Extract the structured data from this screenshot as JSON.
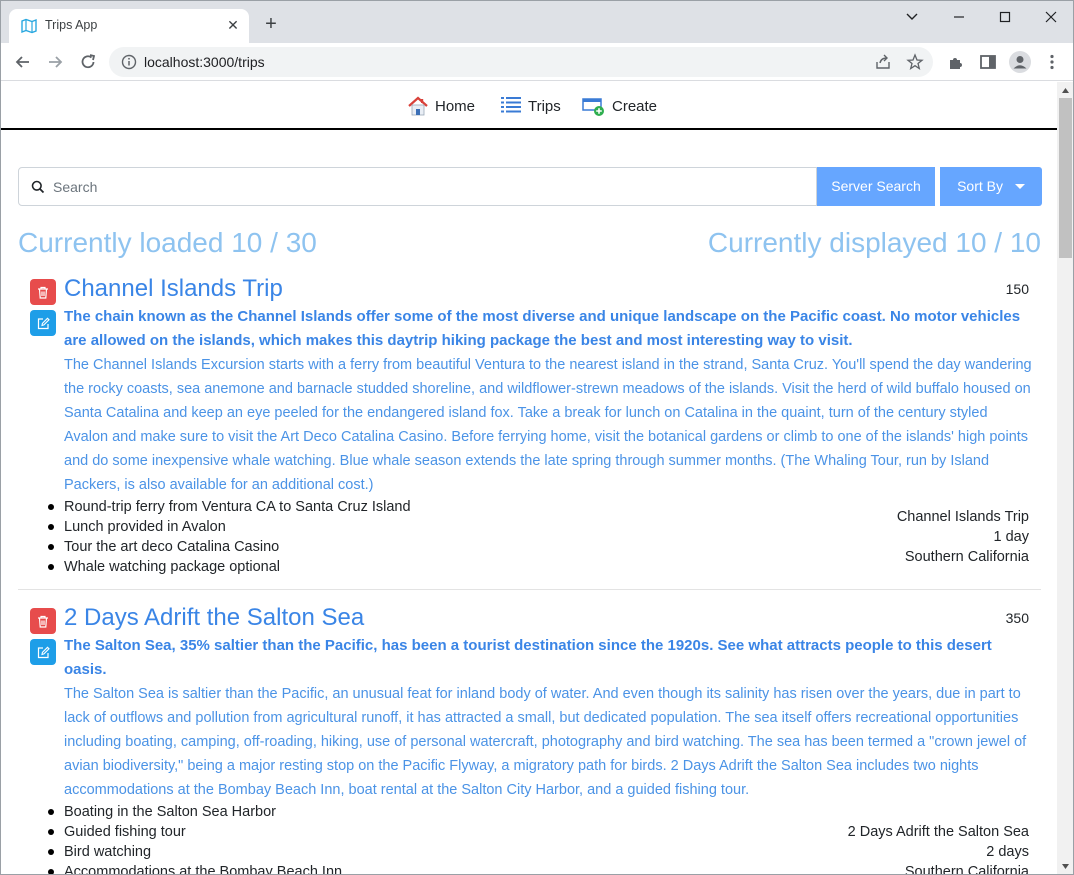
{
  "browser": {
    "tab_title": "Trips App",
    "tab_close": "✕",
    "new_tab": "+",
    "url": "localhost:3000/trips",
    "min": "—",
    "max": "☐",
    "close": "✕"
  },
  "nav": {
    "home": "Home",
    "trips": "Trips",
    "create": "Create"
  },
  "search": {
    "placeholder": "Search",
    "value": "",
    "server_search_label": "Server Search",
    "sort_by_label": "Sort By"
  },
  "status": {
    "loaded": "Currently loaded 10 / 30",
    "displayed": "Currently displayed 10 / 10"
  },
  "trips": [
    {
      "title": "Channel Islands Trip",
      "price": "150",
      "summary": "The chain known as the Channel Islands offer some of the most diverse and unique landscape on the Pacific coast. No motor vehicles are allowed on the islands, which makes this daytrip hiking package the best and most interesting way to visit.",
      "description": "The Channel Islands Excursion starts with a ferry from beautiful Ventura to the nearest island in the strand, Santa Cruz. You'll spend the day wandering the rocky coasts, sea anemone and barnacle studded shoreline, and wildflower-strewn meadows of the islands. Visit the herd of wild buffalo housed on Santa Catalina and keep an eye peeled for the endangered island fox. Take a break for lunch on Catalina in the quaint, turn of the century styled Avalon and make sure to visit the Art Deco Catalina Casino. Before ferrying home, visit the botanical gardens or climb to one of the islands' high points and do some inexpensive whale watching. Blue whale season extends the late spring through summer months. (The Whaling Tour, run by Island Packers, is also available for an additional cost.)",
      "bullets": [
        "Round-trip ferry from Ventura CA to Santa Cruz Island",
        "Lunch provided in Avalon",
        "Tour the art deco Catalina Casino",
        "Whale watching package optional"
      ],
      "meta_name": "Channel Islands Trip",
      "meta_duration": "1 day",
      "meta_region": "Southern California"
    },
    {
      "title": "2 Days Adrift the Salton Sea",
      "price": "350",
      "summary": "The Salton Sea, 35% saltier than the Pacific, has been a tourist destination since the 1920s. See what attracts people to this desert oasis.",
      "description": "The Salton Sea is saltier than the Pacific, an unusual feat for inland body of water. And even though its salinity has risen over the years, due in part to lack of outflows and pollution from agricultural runoff, it has attracted a small, but dedicated population. The sea itself offers recreational opportunities including boating, camping, off-roading, hiking, use of personal watercraft, photography and bird watching. The sea has been termed a \"crown jewel of avian biodiversity,\" being a major resting stop on the Pacific Flyway, a migratory path for birds. 2 Days Adrift the Salton Sea includes two nights accommodations at the Bombay Beach Inn, boat rental at the Salton City Harbor, and a guided fishing tour.",
      "bullets": [
        "Boating in the Salton Sea Harbor",
        "Guided fishing tour",
        "Bird watching",
        "Accommodations at the Bombay Beach Inn"
      ],
      "meta_name": "2 Days Adrift the Salton Sea",
      "meta_duration": "2 days",
      "meta_region": "Southern California"
    }
  ]
}
